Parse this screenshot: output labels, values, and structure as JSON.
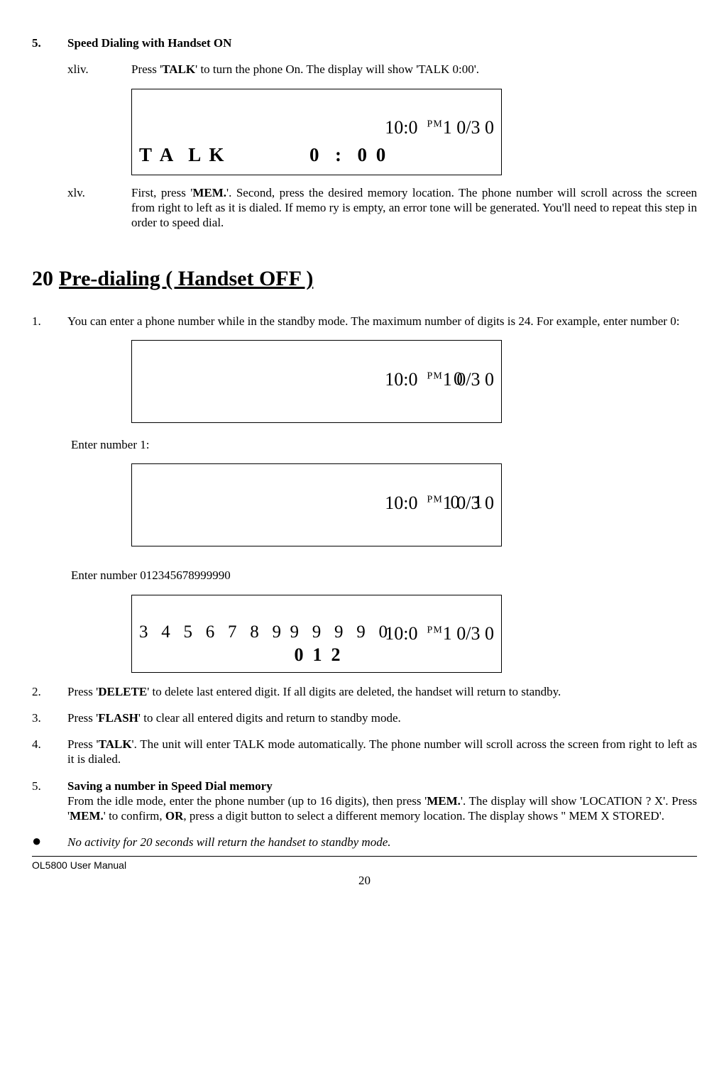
{
  "section5": {
    "num": "5.",
    "title": "Speed Dialing with Handset ON",
    "xliv": {
      "label": "xliv.",
      "text_before": "Press '",
      "key": "TALK",
      "text_after": "' to turn the phone On. The display will show 'TALK   0:00'."
    },
    "xlv": {
      "label": "xlv.",
      "t1": "First, press '",
      "k1": "MEM.",
      "t2": "'. Second, press the desired memory location. The phone number will scroll across the screen from right to left as it is dialed. If memo ry is empty, an error tone will be generated. You'll need to repeat this step in order to speed dial."
    }
  },
  "lcd1": {
    "time_left": "10:0",
    "pm": "PM",
    "time_right": "1 0/3 0",
    "talk_left": "T A  L K",
    "talk_right": "0  :  0 0"
  },
  "section20": {
    "num": "20",
    "title": "Pre-dialing ( Handset OFF )"
  },
  "step1": {
    "num": "1.",
    "text": "You can enter a phone number while in the standby mode.  The maximum number of digits is 24. For example, enter number 0:"
  },
  "lcd2": {
    "time_left": "10:0",
    "pm": "PM",
    "time_right": "1 0/3 0",
    "line2": "0"
  },
  "enter1": "Enter number 1:",
  "lcd3": {
    "time_left": "10:0",
    "pm": "PM",
    "time_right": "1 0/3 0",
    "line2": "0   1"
  },
  "enter2": "Enter number 012345678999990",
  "lcd4": {
    "time_left": "10:0",
    "pm": "PM",
    "time_right": "1 0/3 0",
    "line2": "3   4   5   6   7   8   9  9   9   9   9   0",
    "line3": "0  1  2"
  },
  "step2": {
    "num": "2.",
    "t1": "Press '",
    "k1": "DELETE",
    "t2": "' to delete last entered digit. If all digits are deleted, the handset will return to standby."
  },
  "step3": {
    "num": "3.",
    "t1": "Press '",
    "k1": "FLASH",
    "t2": "' to clear all entered digits and return to standby mode."
  },
  "step4": {
    "num": "4.",
    "t1": "Press '",
    "k1": "TALK",
    "t2": "'. The unit will enter TALK mode automatically. The phone number will scroll across the screen from right to left as it is dialed."
  },
  "step5": {
    "num": "5.",
    "title": "Saving a number in Speed Dial memory",
    "t1": "From the idle mode, enter the phone number (up to 16 digits), then press '",
    "k1": "MEM.",
    "t2": "'.  The display will show 'LOCATION ?  X'. Press '",
    "k2": "MEM.",
    "t3": "' to confirm, ",
    "or": "OR",
    "t4": ",  press a digit button to select a different memory location. The display shows \" MEM  X  STORED'."
  },
  "bullet_note": "No activity for 20 seconds will return the handset to standby mode.",
  "footer": {
    "left": "OL5800 User Manual",
    "page": "20"
  }
}
